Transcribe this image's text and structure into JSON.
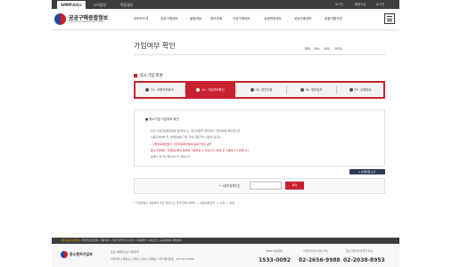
{
  "topbar": {
    "tabs": [
      "SMPP서비스",
      "나의업무",
      "직접생산"
    ],
    "util": [
      "로그인",
      "회원가입",
      "로그인"
    ]
  },
  "header": {
    "logo_title": "공공구매종합정보",
    "logo_sub": "Public Procurement Information",
    "gnb": [
      "SMPP소개",
      "공공구매제도",
      "알림마당",
      "정보조회",
      "사업구매제도",
      "성생판정제도",
      "성능인증제도",
      "성종지원사업"
    ]
  },
  "page": {
    "title": "가입여부 확인",
    "tools": [
      "확대",
      "축소",
      "RSS",
      "프린트"
    ]
  },
  "section": {
    "title": "중소기업 회원"
  },
  "steps": [
    {
      "label": "01. 이용약관동의",
      "active": false
    },
    {
      "label": "02. 가입여부확인",
      "active": true
    },
    {
      "label": "03. 본인인증",
      "active": false
    },
    {
      "label": "04. 정보입력",
      "active": false
    },
    {
      "label": "05. 신청완료",
      "active": false
    }
  ],
  "info": {
    "heading": "중소기업 가입여부 확인",
    "lines": [
      {
        "text": "먼저 사업자등록번호를 입력하시고, 확인버튼을 클릭하여 가입여부를 확인합니다.",
        "red": false
      },
      {
        "text": "이용자격여부 및 상세정보를 기입 후에 회원가입 신청을 합니다.",
        "red": false
      },
      {
        "text": "- 사업자등록번호가 사업자등록번호에 중복가입된 경우",
        "red": true
      },
      {
        "text": "중소기업확인, 직접생산확인 등에서 가용하실 수 없습니다. 확인 후 이용하시기 바랍니다.",
        "red": true
      },
      {
        "text": "중복이 없거나 확인하시기 바랍니다.",
        "red": false
      }
    ],
    "more_button": "상세내용 보기"
  },
  "form": {
    "label_mark": "*",
    "label": "사업자등록번호",
    "input_value": "",
    "button": "확인"
  },
  "notice": "* 가입대상이 유효하지 않은 업정으로 인해 전체 내역화 -> 공동정보입력 -> 신청 -> 완료",
  "footer": {
    "links": [
      "개인정보처리방침",
      "저작권보호정책",
      "이용약관",
      "전자우편무단수집거부",
      "이용방법",
      "사이트맵",
      "공공데이터 개방정책"
    ],
    "logo_text": "중소벤처기업부",
    "addr": [
      "공공구매종합정보 이용문의",
      "서울특별시 영등포구 대방로 서울시 (대방동) 사업자등록번호 : 107-81-07995"
    ],
    "phone_labels": [
      "SMPP 이용문의",
      "직접생산확인 문의 안내",
      "중소기업확인서 발급 안내"
    ],
    "phones": [
      "1533-0092",
      "02-2656-9988",
      "02-2038-8953"
    ]
  },
  "colors": {
    "accent": "#c8202f",
    "dark": "#3d3d3d",
    "navy": "#2c3e57"
  }
}
